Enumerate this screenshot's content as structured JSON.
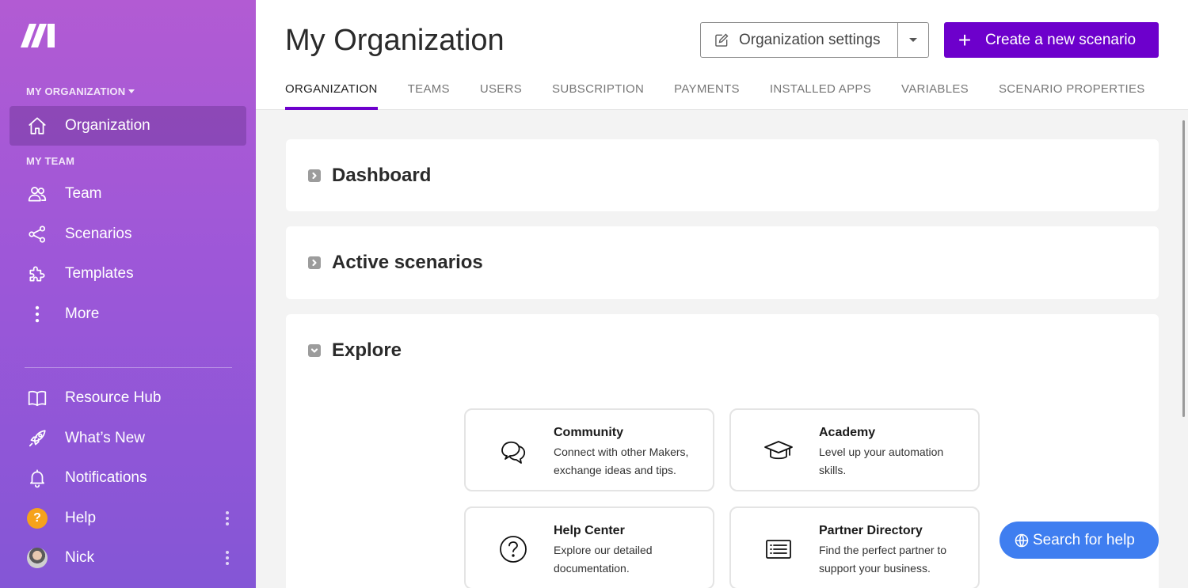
{
  "sidebar": {
    "org_label": "MY ORGANIZATION",
    "team_label": "MY TEAM",
    "items": [
      {
        "label": "Organization",
        "icon": "home-icon"
      },
      {
        "label": "Team",
        "icon": "users-icon"
      },
      {
        "label": "Scenarios",
        "icon": "share-icon"
      },
      {
        "label": "Templates",
        "icon": "puzzle-icon"
      },
      {
        "label": "More",
        "icon": "vertical-dots-icon"
      },
      {
        "label": "Resource Hub",
        "icon": "book-icon"
      },
      {
        "label": "What’s New",
        "icon": "rocket-icon"
      },
      {
        "label": "Notifications",
        "icon": "bell-icon"
      },
      {
        "label": "Help",
        "icon": "help-badge-icon"
      },
      {
        "label": "Nick",
        "icon": "avatar"
      }
    ],
    "help_badge": "?"
  },
  "header": {
    "title": "My Organization",
    "org_settings_label": "Organization settings",
    "create_label": "Create a new scenario",
    "create_plus": "+",
    "tabs": [
      "ORGANIZATION",
      "TEAMS",
      "USERS",
      "SUBSCRIPTION",
      "PAYMENTS",
      "INSTALLED APPS",
      "VARIABLES",
      "SCENARIO PROPERTIES"
    ]
  },
  "sections": [
    {
      "title": "Dashboard",
      "expanded": false
    },
    {
      "title": "Active scenarios",
      "expanded": false
    },
    {
      "title": "Explore",
      "expanded": true
    }
  ],
  "explore": [
    {
      "title": "Community",
      "desc": "Connect with other Makers, exchange ideas and tips.",
      "icon": "chat-bubbles-icon"
    },
    {
      "title": "Academy",
      "desc": "Level up your automation skills.",
      "icon": "graduation-cap-icon"
    },
    {
      "title": "Help Center",
      "desc": "Explore our detailed documentation.",
      "icon": "question-circle-icon"
    },
    {
      "title": "Partner Directory",
      "desc": "Find the perfect partner to support your business.",
      "icon": "list-icon"
    }
  ],
  "search_help_label": "Search for help",
  "colors": {
    "accent": "#6d00cc",
    "help_button": "#3f7ef0",
    "badge": "#f6a21c"
  }
}
